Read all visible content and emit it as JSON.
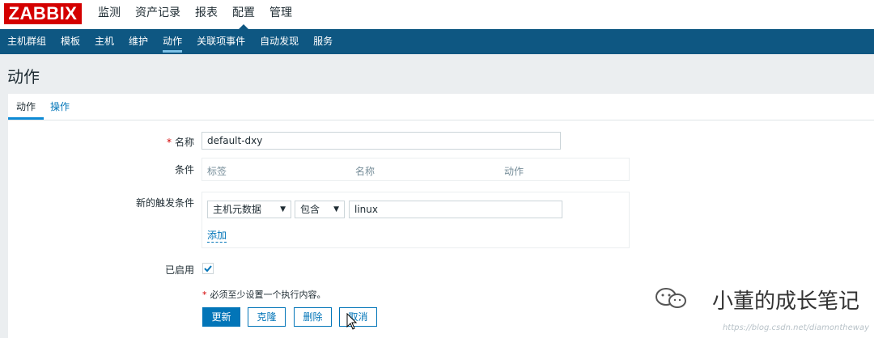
{
  "logo": "ZABBIX",
  "main_menu": [
    "监测",
    "资产记录",
    "报表",
    "配置",
    "管理"
  ],
  "sub_menu": [
    "主机群组",
    "模板",
    "主机",
    "维护",
    "动作",
    "关联项事件",
    "自动发现",
    "服务"
  ],
  "page_title": "动作",
  "tabs": [
    "动作",
    "操作"
  ],
  "form": {
    "name_label": "名称",
    "name_value": "default-dxy",
    "conditions_label": "条件",
    "conditions_headers": [
      "标签",
      "名称",
      "动作"
    ],
    "new_condition_label": "新的触发条件",
    "condition_type": "主机元数据",
    "condition_operator": "包含",
    "condition_value": "linux",
    "add_link": "添加",
    "enabled_label": "已启用",
    "enabled": true,
    "note": "必须至少设置一个执行内容。",
    "required_mark": "*"
  },
  "buttons": {
    "update": "更新",
    "clone": "克隆",
    "delete": "删除",
    "cancel": "取消"
  },
  "watermark": {
    "text": "小董的成长笔记",
    "url": "https://blog.csdn.net/diamontheway"
  },
  "colors": {
    "brand": "#d40000",
    "nav": "#0e5782",
    "link": "#0275b8"
  }
}
